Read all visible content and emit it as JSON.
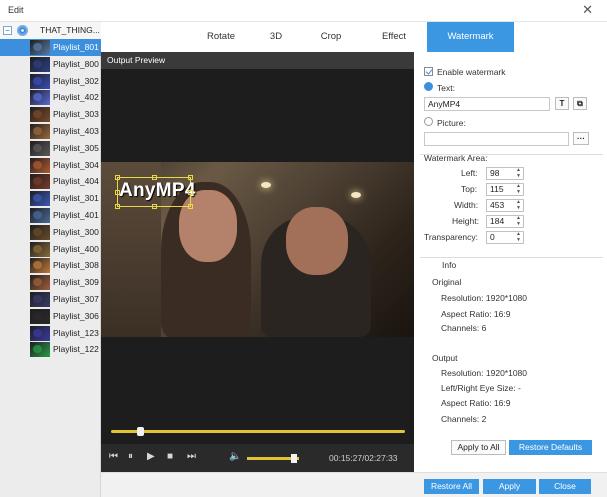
{
  "window": {
    "title": "Edit",
    "close_glyph": "✕"
  },
  "playlist": {
    "root_label": "THAT_THING...",
    "items": [
      {
        "name": "Playlist_801",
        "active": true,
        "thumb": "#5a7ba6"
      },
      {
        "name": "Playlist_800",
        "active": false,
        "thumb": "#2c3f80"
      },
      {
        "name": "Playlist_302",
        "active": false,
        "thumb": "#3a4db8"
      },
      {
        "name": "Playlist_402",
        "active": false,
        "thumb": "#5a6ad8"
      },
      {
        "name": "Playlist_303",
        "active": false,
        "thumb": "#7a4a2a"
      },
      {
        "name": "Playlist_403",
        "active": false,
        "thumb": "#9a6a3e"
      },
      {
        "name": "Playlist_305",
        "active": false,
        "thumb": "#5a5a5a"
      },
      {
        "name": "Playlist_304",
        "active": false,
        "thumb": "#b05a30"
      },
      {
        "name": "Playlist_404",
        "active": false,
        "thumb": "#7a3a2a"
      },
      {
        "name": "Playlist_301",
        "active": false,
        "thumb": "#3a5ab8"
      },
      {
        "name": "Playlist_401",
        "active": false,
        "thumb": "#4a6a9a"
      },
      {
        "name": "Playlist_300",
        "active": false,
        "thumb": "#6a4a2a"
      },
      {
        "name": "Playlist_400",
        "active": false,
        "thumb": "#8a6a3a"
      },
      {
        "name": "Playlist_308",
        "active": false,
        "thumb": "#c07a3a"
      },
      {
        "name": "Playlist_309",
        "active": false,
        "thumb": "#a0603a"
      },
      {
        "name": "Playlist_307",
        "active": false,
        "thumb": "#3a3a6a"
      },
      {
        "name": "Playlist_306",
        "active": false,
        "thumb": "#2a2a2a"
      },
      {
        "name": "Playlist_123",
        "active": false,
        "thumb": "#3a3aa0"
      },
      {
        "name": "Playlist_122",
        "active": false,
        "thumb": "#2a9a4a"
      }
    ]
  },
  "tabs": [
    {
      "label": "Rotate",
      "active": false
    },
    {
      "label": "3D",
      "active": false
    },
    {
      "label": "Crop",
      "active": false
    },
    {
      "label": "Effect",
      "active": false
    },
    {
      "label": "Watermark",
      "active": true
    }
  ],
  "preview": {
    "header": "Output Preview",
    "watermark_text": "AnyMP4",
    "time": "00:15:27/02:27:33",
    "progress_fraction": 0.1,
    "volume_fraction": 0.9,
    "icons": [
      "prev-icon",
      "pause-icon",
      "play-icon",
      "stop-icon",
      "next-icon",
      "volume-icon"
    ]
  },
  "watermark": {
    "enable_label": "Enable watermark",
    "enabled": true,
    "text_label": "Text:",
    "text_value": "AnyMP4",
    "text_btn": "T",
    "picture_label": "Picture:",
    "picture_value": "",
    "browse_label": "···",
    "area_label": "Watermark Area:",
    "fields": [
      {
        "label": "Left:",
        "value": "98"
      },
      {
        "label": "Top:",
        "value": "115"
      },
      {
        "label": "Width:",
        "value": "453"
      },
      {
        "label": "Height:",
        "value": "184"
      },
      {
        "label": "Transparency:",
        "value": "0"
      }
    ]
  },
  "info": {
    "title": "Info",
    "original_title": "Original",
    "original": [
      "Resolution: 1920*1080",
      "Aspect Ratio: 16:9",
      "Channels: 6"
    ],
    "output_title": "Output",
    "output": [
      "Resolution: 1920*1080",
      "Left/Right Eye Size: -",
      "Aspect Ratio: 16:9",
      "Channels: 2"
    ]
  },
  "buttons": {
    "apply_to_all": "Apply to All",
    "restore_defaults": "Restore Defaults",
    "restore_all": "Restore All",
    "apply": "Apply",
    "close": "Close"
  }
}
